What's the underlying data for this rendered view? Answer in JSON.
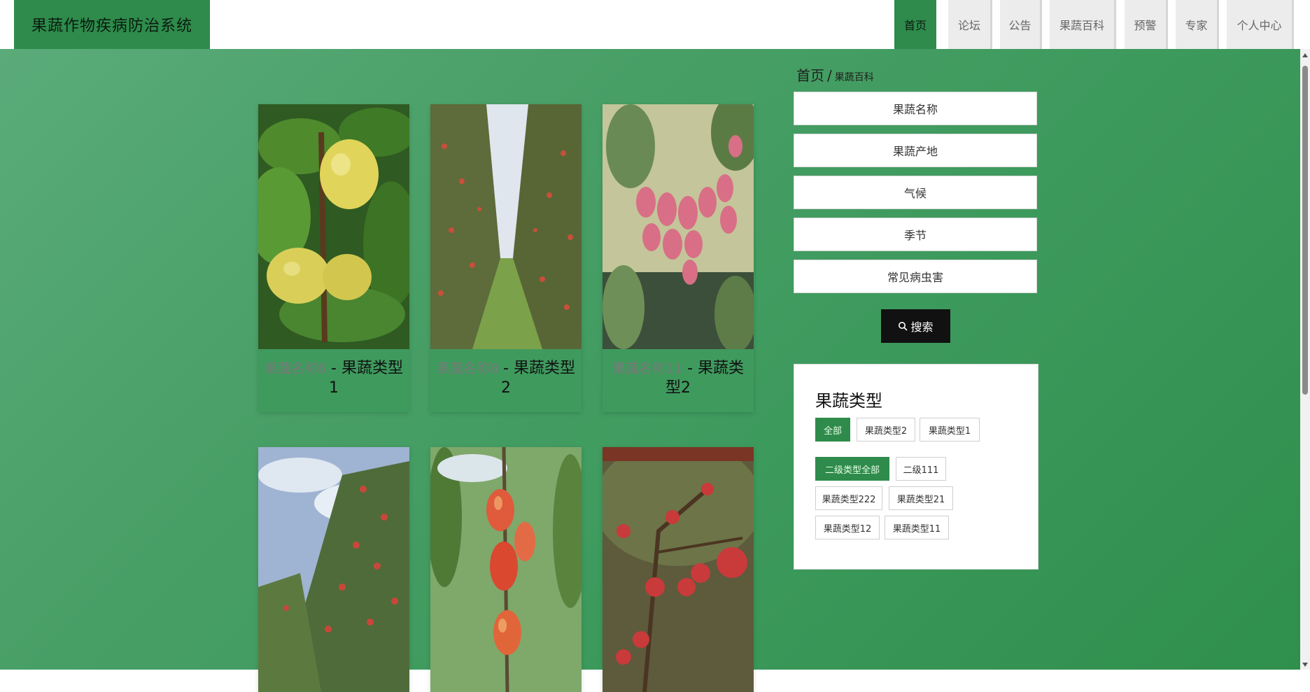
{
  "header": {
    "brand": "果蔬作物疾病防治系统",
    "nav": [
      {
        "label": "首页",
        "active": true
      },
      {
        "label": "论坛",
        "active": false
      },
      {
        "label": "公告",
        "active": false
      },
      {
        "label": "果蔬百科",
        "active": false
      },
      {
        "label": "预警",
        "active": false
      },
      {
        "label": "专家",
        "active": false
      },
      {
        "label": "个人中心",
        "active": false
      }
    ]
  },
  "products": [
    {
      "name": "果蔬名称6",
      "separator": " - ",
      "type": "果蔬类型1"
    },
    {
      "name": "果蔬名称8",
      "separator": " - ",
      "type": "果蔬类型2"
    },
    {
      "name": "果蔬名称11",
      "separator": " - ",
      "type": "果蔬类型2"
    },
    {
      "name": "",
      "separator": "",
      "type": ""
    },
    {
      "name": "",
      "separator": "",
      "type": ""
    },
    {
      "name": "",
      "separator": "",
      "type": ""
    }
  ],
  "breadcrumb": {
    "home": "首页",
    "separator": "/",
    "current": "果蔬百科"
  },
  "search": {
    "fields": [
      {
        "placeholder": "果蔬名称"
      },
      {
        "placeholder": "果蔬产地"
      },
      {
        "placeholder": "气候"
      },
      {
        "placeholder": "季节"
      },
      {
        "placeholder": "常见病虫害"
      }
    ],
    "button_label": "搜索"
  },
  "types_panel": {
    "title": "果蔬类型",
    "primary_tags": [
      {
        "label": "全部",
        "active": true
      },
      {
        "label": "果蔬类型2",
        "active": false
      },
      {
        "label": "果蔬类型1",
        "active": false
      }
    ],
    "secondary_tags": [
      {
        "label": "二级类型全部",
        "active": true
      },
      {
        "label": "二级111",
        "active": false
      },
      {
        "label": "果蔬类型222",
        "active": false
      },
      {
        "label": "果蔬类型21",
        "active": false
      },
      {
        "label": "果蔬类型12",
        "active": false
      },
      {
        "label": "果蔬类型11",
        "active": false
      }
    ]
  },
  "colors": {
    "accent": "#2e8b4b",
    "background_green": "#3d9a5d",
    "button_dark": "#111111"
  }
}
